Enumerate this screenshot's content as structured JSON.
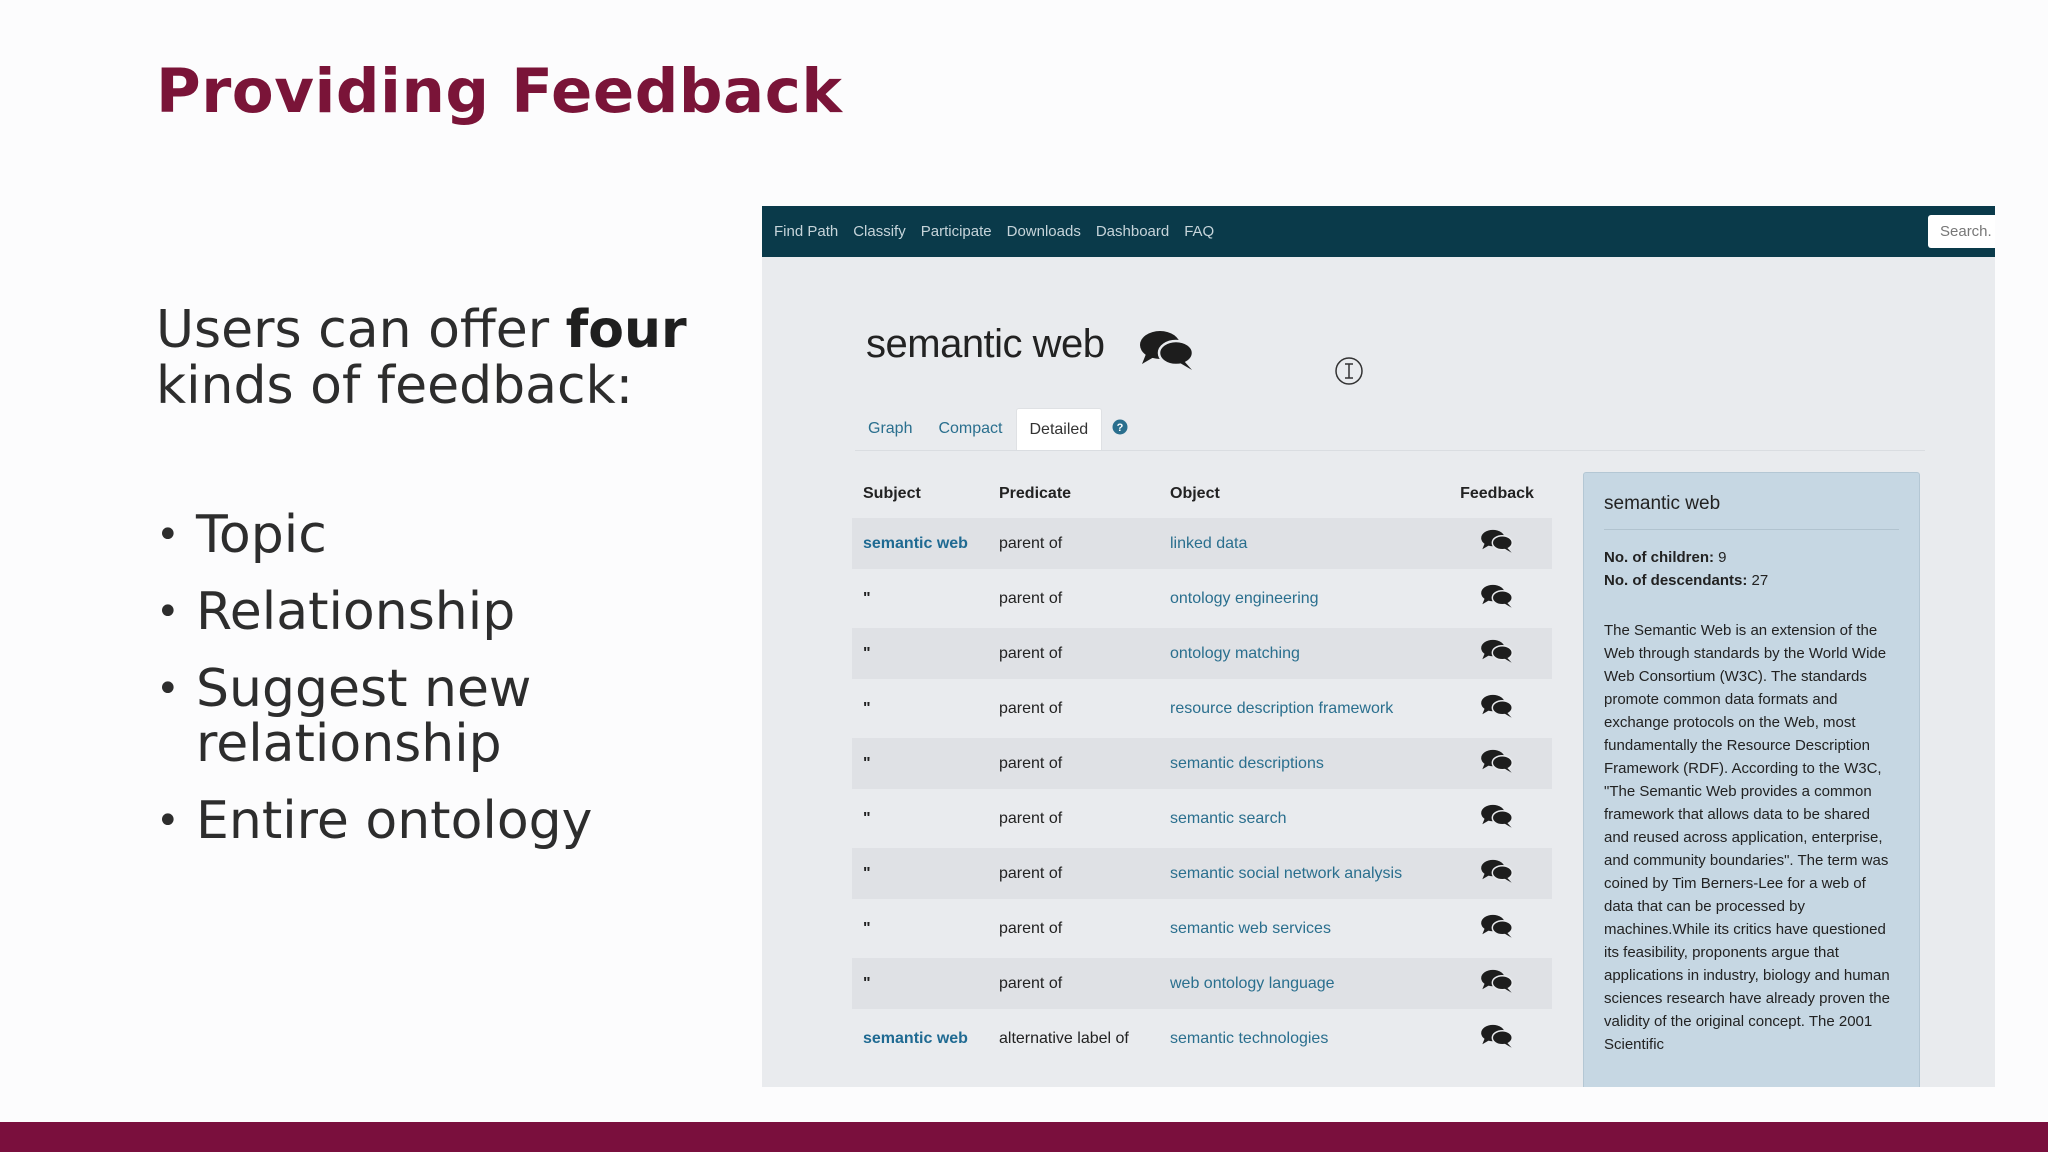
{
  "slide": {
    "title": "Providing Feedback",
    "intro_pre": "Users can offer ",
    "intro_bold": "four",
    "intro_post": " kinds of feedback:",
    "bullets": [
      "Topic",
      "Relationship",
      "Suggest new relationship",
      "Entire ontology"
    ]
  },
  "app": {
    "nav": [
      "Find Path",
      "Classify",
      "Participate",
      "Downloads",
      "Dashboard",
      "FAQ"
    ],
    "search_placeholder": "Search.",
    "topic_title": "semantic web",
    "tabs": [
      "Graph",
      "Compact",
      "Detailed"
    ],
    "active_tab": "Detailed",
    "table": {
      "headers": [
        "Subject",
        "Predicate",
        "Object",
        "Feedback"
      ],
      "rows": [
        {
          "subject": "semantic web",
          "predicate": "parent of",
          "object": "linked data"
        },
        {
          "subject": "\"",
          "predicate": "parent of",
          "object": "ontology engineering"
        },
        {
          "subject": "\"",
          "predicate": "parent of",
          "object": "ontology matching"
        },
        {
          "subject": "\"",
          "predicate": "parent of",
          "object": "resource description framework"
        },
        {
          "subject": "\"",
          "predicate": "parent of",
          "object": "semantic descriptions"
        },
        {
          "subject": "\"",
          "predicate": "parent of",
          "object": "semantic search"
        },
        {
          "subject": "\"",
          "predicate": "parent of",
          "object": "semantic social network analysis"
        },
        {
          "subject": "\"",
          "predicate": "parent of",
          "object": "semantic web services"
        },
        {
          "subject": "\"",
          "predicate": "parent of",
          "object": "web ontology language"
        },
        {
          "subject": "semantic web",
          "predicate": "alternative label of",
          "object": "semantic technologies"
        }
      ]
    },
    "panel": {
      "title": "semantic web",
      "children_label": "No. of children:",
      "children_value": "9",
      "descendants_label": "No. of descendants:",
      "descendants_value": "27",
      "description": "The Semantic Web is an extension of the Web through standards by the World Wide Web Consortium (W3C). The standards promote common data formats and exchange protocols on the Web, most fundamentally the Resource Description Framework (RDF). According to the W3C, \"The Semantic Web provides a common framework that allows data to be shared and reused across application, enterprise, and community boundaries\". The term was coined by Tim Berners-Lee for a web of data that can be processed by machines.While its critics have questioned its feasibility, proponents argue that applications in industry, biology and human sciences research have already proven the validity of the original concept. The 2001 Scientific"
    }
  },
  "colors": {
    "title": "#7a1438",
    "footer_bar": "#7a0f3d",
    "nav_bg": "#0a3a4a",
    "link": "#2a6f8e",
    "panel_bg": "#c6d7e3"
  }
}
